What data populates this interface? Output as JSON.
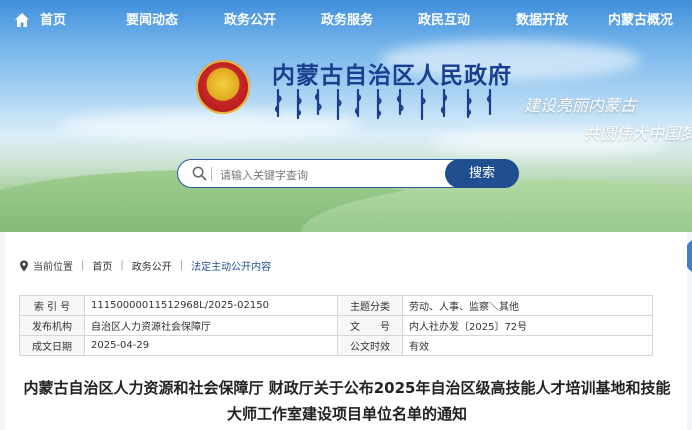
{
  "nav": {
    "items": [
      {
        "label": "首页"
      },
      {
        "label": "要闻动态"
      },
      {
        "label": "政务公开"
      },
      {
        "label": "政务服务"
      },
      {
        "label": "政民互动"
      },
      {
        "label": "数据开放"
      },
      {
        "label": "内蒙古概况"
      }
    ]
  },
  "header": {
    "title": "内蒙古自治区人民政府",
    "slogan_line1": "建设亮丽内蒙古",
    "slogan_line2": "共圆伟大中国梦"
  },
  "search": {
    "placeholder": "请输入关键字查询",
    "button_label": "搜索"
  },
  "breadcrumb": {
    "prefix": "当前位置",
    "items": [
      "首页",
      "政务公开",
      "法定主动公开内容"
    ]
  },
  "meta": {
    "rows": [
      {
        "k1": "索 引 号",
        "v1": "11150000011512968L/2025-02150",
        "k2": "主题分类",
        "v2": "劳动、人事、监察＼其他"
      },
      {
        "k1": "发布机构",
        "v1": "自治区人力资源社会保障厅",
        "k2": "文　　号",
        "v2": "内人社办发〔2025〕72号"
      },
      {
        "k1": "成文日期",
        "v1": "2025-04-29",
        "k2": "公文时效",
        "v2": "有效"
      }
    ]
  },
  "document": {
    "title": "内蒙古自治区人力资源和社会保障厅 财政厅关于公布2025年自治区级高技能人才培训基地和技能大师工作室建设项目单位名单的通知"
  },
  "colors": {
    "brand_blue": "#1f4f8f",
    "title_blue": "#1b3f8f"
  }
}
